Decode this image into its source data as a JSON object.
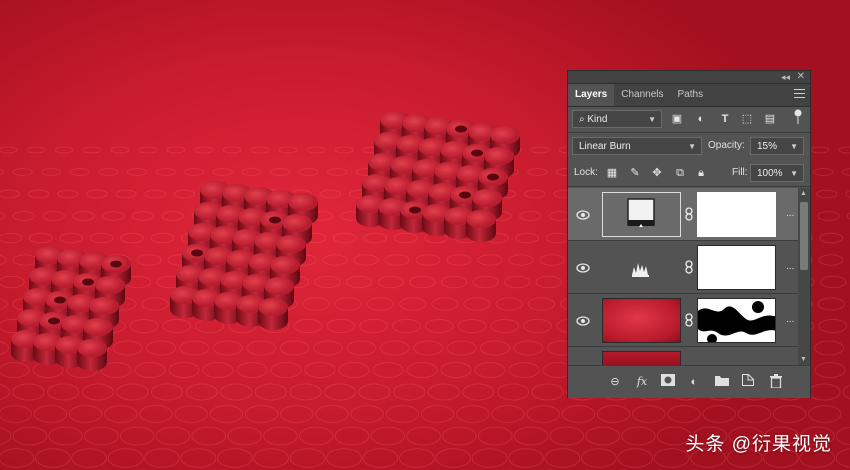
{
  "panel": {
    "tabs": [
      {
        "label": "Layers",
        "active": true
      },
      {
        "label": "Channels",
        "active": false
      },
      {
        "label": "Paths",
        "active": false
      }
    ],
    "filter_kind": "Kind",
    "blend_mode": "Linear Burn",
    "opacity_label": "Opacity:",
    "opacity_value": "15%",
    "lock_label": "Lock:",
    "fill_label": "Fill:",
    "fill_value": "100%",
    "layers": [
      {
        "name": "adjustment-levels",
        "visible": true,
        "selected": true
      },
      {
        "name": "adjustment-histogram",
        "visible": true,
        "selected": false
      },
      {
        "name": "red-texture-with-mask",
        "visible": true,
        "selected": false
      },
      {
        "name": "red-texture",
        "visible": true,
        "selected": false
      }
    ]
  },
  "watermark": "头条 @衍果视觉",
  "colors": {
    "background": "#c81b2e",
    "panel": "#535353",
    "panel_dark": "#424242"
  }
}
